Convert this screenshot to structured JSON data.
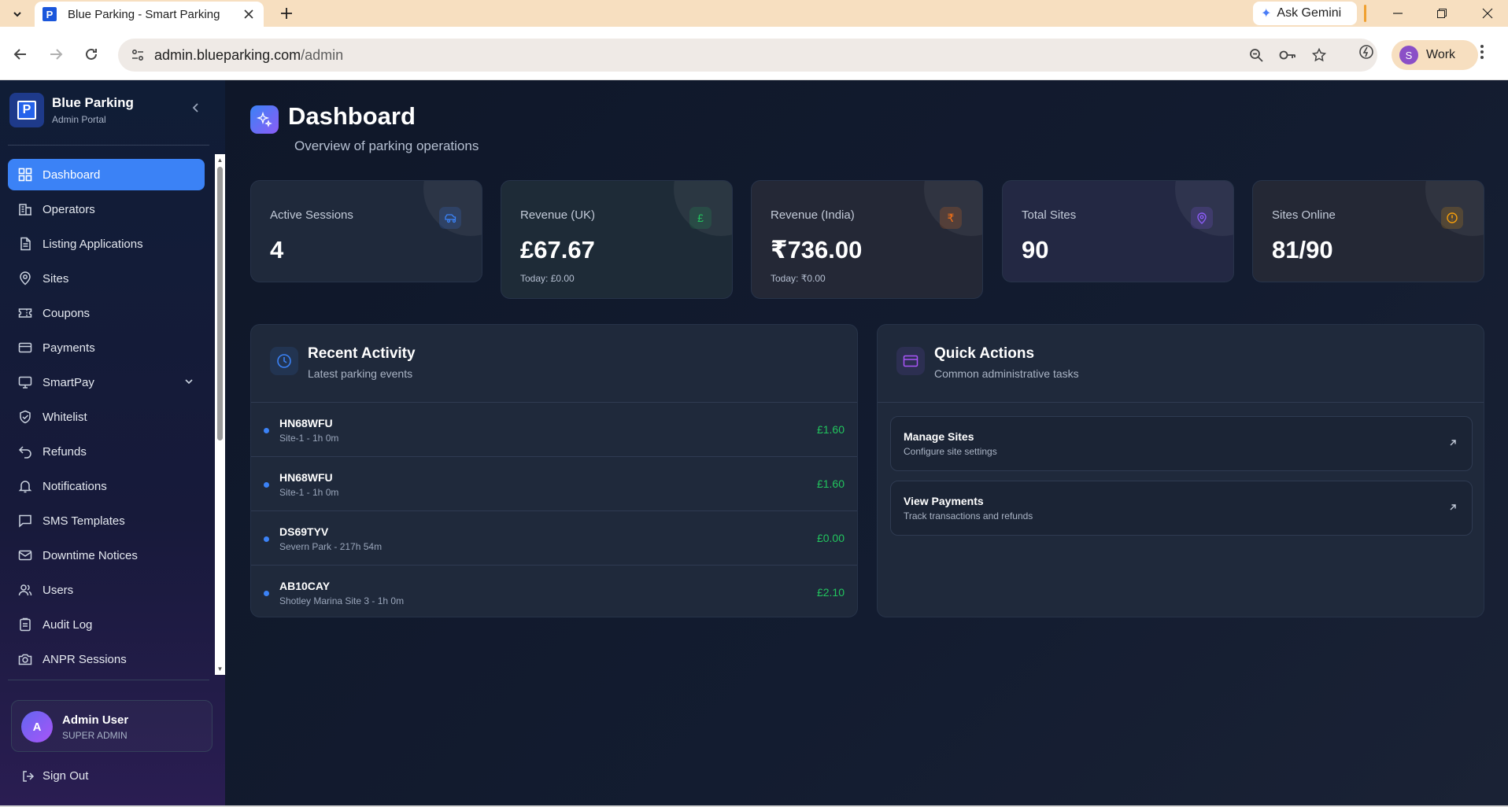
{
  "browser": {
    "tab_title": "Blue Parking - Smart Parking",
    "favicon_letter": "P",
    "url_host": "admin.blueparking.com",
    "url_path": "/admin",
    "gemini_label": "Ask Gemini",
    "profile_initial": "S",
    "profile_label": "Work"
  },
  "sidebar": {
    "brand_letter": "P",
    "brand_name": "Blue Parking",
    "brand_sub": "Admin Portal",
    "items": [
      {
        "label": "Dashboard",
        "icon": "dashboard-icon",
        "active": true
      },
      {
        "label": "Operators",
        "icon": "building-icon"
      },
      {
        "label": "Listing Applications",
        "icon": "document-icon"
      },
      {
        "label": "Sites",
        "icon": "map-pin-icon"
      },
      {
        "label": "Coupons",
        "icon": "ticket-icon"
      },
      {
        "label": "Payments",
        "icon": "credit-card-icon"
      },
      {
        "label": "SmartPay",
        "icon": "monitor-icon",
        "expandable": true
      },
      {
        "label": "Whitelist",
        "icon": "shield-check-icon"
      },
      {
        "label": "Refunds",
        "icon": "undo-icon"
      },
      {
        "label": "Notifications",
        "icon": "bell-icon"
      },
      {
        "label": "SMS Templates",
        "icon": "message-icon"
      },
      {
        "label": "Downtime Notices",
        "icon": "mail-icon"
      },
      {
        "label": "Users",
        "icon": "users-icon"
      },
      {
        "label": "Audit Log",
        "icon": "clipboard-icon"
      },
      {
        "label": "ANPR Sessions",
        "icon": "camera-icon"
      }
    ],
    "user": {
      "initial": "A",
      "name": "Admin User",
      "role": "SUPER ADMIN"
    },
    "sign_out": "Sign Out"
  },
  "page": {
    "title": "Dashboard",
    "subtitle": "Overview of parking operations"
  },
  "stats": [
    {
      "label": "Active Sessions",
      "value": "4",
      "sub": "",
      "icon": "car-icon",
      "color": "#3b82f6"
    },
    {
      "label": "Revenue (UK)",
      "value": "£67.67",
      "sub": "Today: £0.00",
      "icon": "pound-icon",
      "color": "#22c55e"
    },
    {
      "label": "Revenue (India)",
      "value": "₹736.00",
      "sub": "Today: ₹0.00",
      "icon": "rupee-icon",
      "color": "#f97316"
    },
    {
      "label": "Total Sites",
      "value": "90",
      "sub": "",
      "icon": "map-pin-icon",
      "color": "#8b5cf6"
    },
    {
      "label": "Sites Online",
      "value": "81/90",
      "sub": "",
      "icon": "alert-circle-icon",
      "color": "#f59e0b"
    }
  ],
  "recent_activity": {
    "title": "Recent Activity",
    "subtitle": "Latest parking events",
    "rows": [
      {
        "plate": "HN68WFU",
        "meta": "Site-1 - 1h 0m",
        "amount": "£1.60"
      },
      {
        "plate": "HN68WFU",
        "meta": "Site-1 - 1h 0m",
        "amount": "£1.60"
      },
      {
        "plate": "DS69TYV",
        "meta": "Severn Park - 217h 54m",
        "amount": "£0.00"
      },
      {
        "plate": "AB10CAY",
        "meta": "Shotley Marina Site 3 - 1h 0m",
        "amount": "£2.10"
      }
    ]
  },
  "quick_actions": {
    "title": "Quick Actions",
    "subtitle": "Common administrative tasks",
    "items": [
      {
        "title": "Manage Sites",
        "sub": "Configure site settings"
      },
      {
        "title": "View Payments",
        "sub": "Track transactions and refunds"
      }
    ]
  },
  "colors": {
    "accent": "#3b82f6",
    "positive": "#22c55e",
    "bg": "#0f1729",
    "card": "#1f293b"
  }
}
